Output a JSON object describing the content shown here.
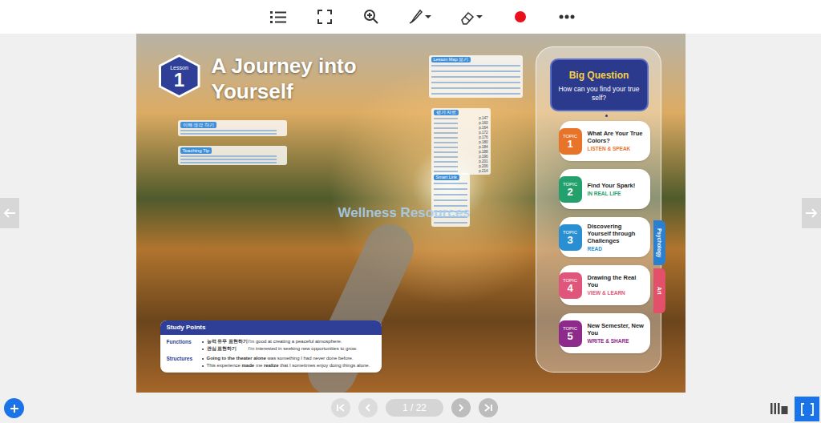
{
  "toolbar": {
    "pen_color": "#e8101a"
  },
  "lesson": {
    "label": "Lesson",
    "number": "1",
    "title": "A Journey into Yourself"
  },
  "notes_left": [
    {
      "title": "이해 생각 하기"
    },
    {
      "title": "Teaching Tip"
    }
  ],
  "notes_right": [
    {
      "title": "Lesson Map 보기",
      "pages": []
    },
    {
      "title": "평가 자료",
      "pages": [
        "p.147",
        "p.160",
        "p.164",
        "p.172",
        "p.176",
        "p.180",
        "p.184",
        "p.188",
        "p.196",
        "p.201",
        "p.206",
        "p.214"
      ]
    },
    {
      "title": "Smart Link",
      "pages": []
    }
  ],
  "watermark": "Wellness Resources",
  "study_points": {
    "title": "Study Points",
    "sections": [
      {
        "label": "Functions",
        "items": [
          {
            "ko": "능력 유무 표현하기",
            "en": [
              {
                "text": "I'm good at creating a peaceful atmosphere.",
                "bold": false
              }
            ]
          },
          {
            "ko": "관심 표현하기",
            "en": [
              {
                "text": "I'm interested in seeking new opportunities to grow.",
                "bold": false
              }
            ]
          }
        ]
      },
      {
        "label": "Structures",
        "items": [
          {
            "ko": "",
            "en": [
              {
                "text": "Going to the theater alone",
                "bold": true
              },
              {
                "text": " was something I had never done before.",
                "bold": false
              }
            ]
          },
          {
            "ko": "",
            "en": [
              {
                "text": "This experience ",
                "bold": false
              },
              {
                "text": "made",
                "bold": true
              },
              {
                "text": " me ",
                "bold": false
              },
              {
                "text": "realize",
                "bold": true
              },
              {
                "text": " that I sometimes enjoy doing things alone.",
                "bold": false
              }
            ]
          }
        ]
      }
    ]
  },
  "big_question": {
    "title": "Big Question",
    "question": "How can you find your true self?"
  },
  "topics": [
    {
      "label": "TOPIC",
      "number": "1",
      "title": "What Are Your True Colors?",
      "type": "LISTEN & SPEAK",
      "color": "#e8742a"
    },
    {
      "label": "TOPIC",
      "number": "2",
      "title": "Find Your Spark!",
      "type": "IN REAL LIFE",
      "color": "#23a06c"
    },
    {
      "label": "TOPIC",
      "number": "3",
      "title": "Discovering Yourself through Challenges",
      "type": "READ",
      "color": "#2a8fd2"
    },
    {
      "label": "TOPIC",
      "number": "4",
      "title": "Drawing the Real You",
      "type": "VIEW & LEARN",
      "color": "#e0567a"
    },
    {
      "label": "TOPIC",
      "number": "5",
      "title": "New Semester, New You",
      "type": "WRITE & SHARE",
      "color": "#8e2a8c"
    }
  ],
  "side_tabs": [
    {
      "label": "Psychology",
      "color": "#2b7fd0"
    },
    {
      "label": "Art",
      "color": "#e2506a"
    }
  ],
  "pagination": {
    "page_label": "1 / 22"
  }
}
